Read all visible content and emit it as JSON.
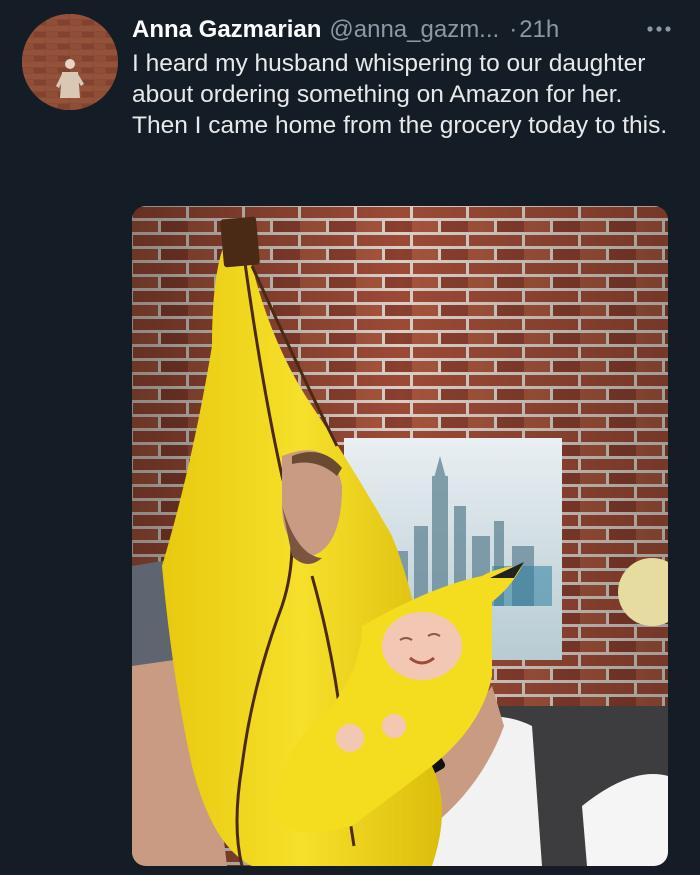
{
  "tweet": {
    "author": {
      "display_name": "Anna Gazmarian",
      "handle": "@anna_gazm...",
      "avatar_icon": "profile-photo"
    },
    "separator": "·",
    "timestamp": "21h",
    "more_icon": "ellipsis-icon",
    "text": "I heard my husband whispering to our daughter about ordering something on Amazon for her. Then I came home from the grocery today to this."
  },
  "colors": {
    "background": "#141d26",
    "name": "#ffffff",
    "secondary": "#8b98a5",
    "text": "#e7e9ea",
    "banana": "#f3d91c"
  }
}
